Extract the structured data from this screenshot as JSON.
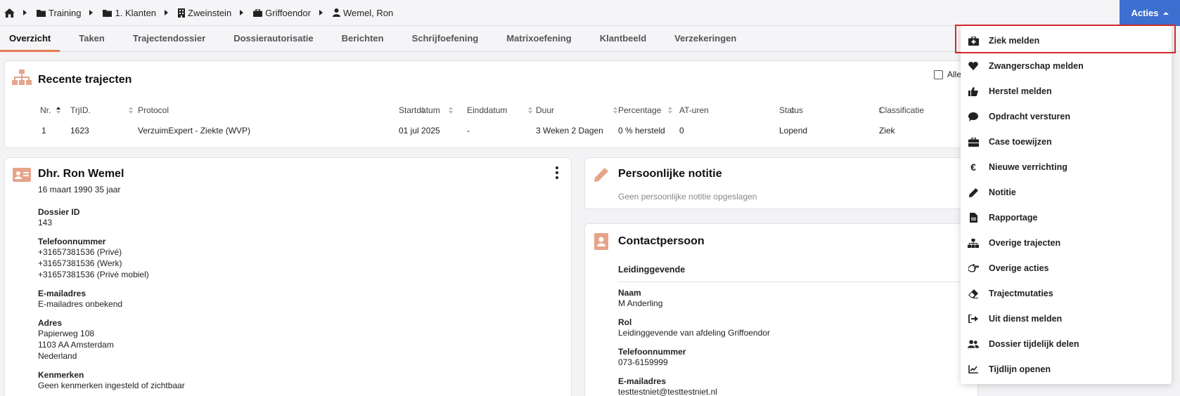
{
  "breadcrumb": [
    {
      "label": "Training",
      "icon": "folder-icon"
    },
    {
      "label": "1. Klanten",
      "icon": "folder-icon"
    },
    {
      "label": "Zweinstein",
      "icon": "building-icon"
    },
    {
      "label": "Griffoendor",
      "icon": "briefcase-icon"
    },
    {
      "label": "Wemel, Ron",
      "icon": "user-icon"
    }
  ],
  "acties_label": "Acties",
  "tabs": [
    "Overzicht",
    "Taken",
    "Trajectendossier",
    "Dossierautorisatie",
    "Berichten",
    "Schrijfoefening",
    "Matrixoefening",
    "Klantbeeld",
    "Verzekeringen"
  ],
  "trajecten": {
    "title": "Recente trajecten",
    "checkbox_label": "Alle",
    "columns": [
      "Nr.",
      "TrjID.",
      "Protocol",
      "Startdatum",
      "Einddatum",
      "Duur",
      "Percentage",
      "AT-uren",
      "Status",
      "Classificatie"
    ],
    "row": [
      "1",
      "1623",
      "VerzuimExpert - Ziekte (WVP)",
      "01 jul 2025",
      "-",
      "3 Weken 2 Dagen",
      "0 % hersteld",
      "0",
      "Lopend",
      "Ziek"
    ]
  },
  "person": {
    "name": "Dhr. Ron Wemel",
    "birth": "16 maart 1990 35 jaar",
    "dossier_label": "Dossier ID",
    "dossier_value": "143",
    "phone_label": "Telefoonnummer",
    "phones": [
      "+31657381536 (Privé)",
      "+31657381536 (Werk)",
      "+31657381536 (Privé mobiel)"
    ],
    "email_label": "E-mailadres",
    "email_value": "E-mailadres onbekend",
    "address_label": "Adres",
    "address_lines": [
      "Papierweg 108",
      "1103 AA Amsterdam",
      "Nederland"
    ],
    "kenmerken_label": "Kenmerken",
    "kenmerken_value": "Geen kenmerken ingesteld of zichtbaar"
  },
  "notitie": {
    "title": "Persoonlijke notitie",
    "empty": "Geen persoonlijke notitie opgeslagen"
  },
  "contact": {
    "title": "Contactpersoon",
    "subtitle": "Leidinggevende",
    "naam_label": "Naam",
    "naam": "M Anderling",
    "rol_label": "Rol",
    "rol": "Leidinggevende van afdeling Griffoendor",
    "phone_label": "Telefoonnummer",
    "phone": "073-6159999",
    "email_label": "E-mailadres",
    "email": "testtestniet@testtestniet.nl"
  },
  "menu": [
    {
      "label": "Ziek melden",
      "icon": "medkit-icon"
    },
    {
      "label": "Zwangerschap melden",
      "icon": "heart-icon"
    },
    {
      "label": "Herstel melden",
      "icon": "thumbs-up-icon"
    },
    {
      "label": "Opdracht versturen",
      "icon": "comment-icon"
    },
    {
      "label": "Case toewijzen",
      "icon": "briefcase-icon"
    },
    {
      "label": "Nieuwe verrichting",
      "icon": "euro-icon"
    },
    {
      "label": "Notitie",
      "icon": "pencil-icon"
    },
    {
      "label": "Rapportage",
      "icon": "file-icon"
    },
    {
      "label": "Overige trajecten",
      "icon": "sitemap-icon"
    },
    {
      "label": "Overige acties",
      "icon": "hand-point-icon"
    },
    {
      "label": "Trajectmutaties",
      "icon": "eraser-icon"
    },
    {
      "label": "Uit dienst melden",
      "icon": "sign-out-icon"
    },
    {
      "label": "Dossier tijdelijk delen",
      "icon": "users-icon"
    },
    {
      "label": "Tijdlijn openen",
      "icon": "chart-line-icon"
    }
  ],
  "colors": {
    "accent": "#3d6fd0",
    "tab_underline": "#e57a54",
    "icon_peach": "#e6a48a",
    "highlight": "#d12b2b"
  }
}
